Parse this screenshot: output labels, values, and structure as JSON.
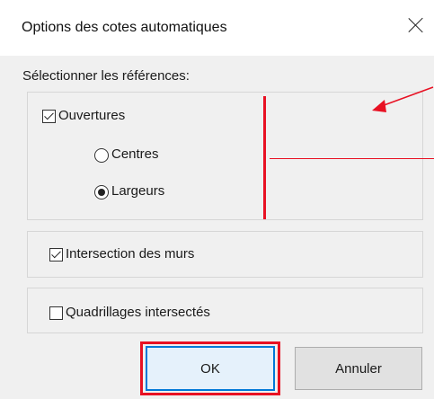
{
  "dialog": {
    "title": "Options des cotes automatiques",
    "close_icon": "close-icon"
  },
  "references": {
    "label": "Sélectionner les références:",
    "openings": {
      "label": "Ouvertures",
      "checked": true
    },
    "centers": {
      "label": "Centres",
      "selected": false
    },
    "widths": {
      "label": "Largeurs",
      "selected": true
    }
  },
  "walls": {
    "label": "Intersection des murs",
    "checked": true
  },
  "grids": {
    "label": "Quadrillages intersectés",
    "checked": false
  },
  "buttons": {
    "ok": "OK",
    "cancel": "Annuler"
  },
  "annotations": {
    "color": "#e81123"
  }
}
